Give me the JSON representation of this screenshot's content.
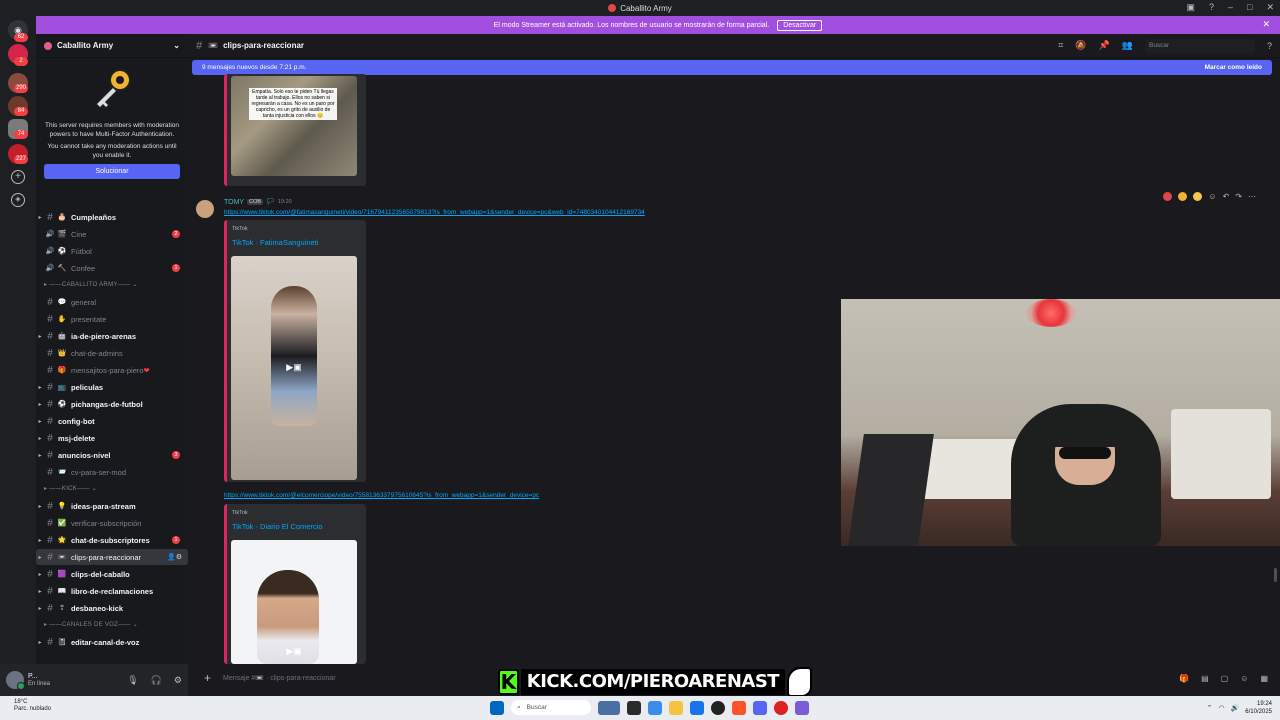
{
  "window": {
    "title": "Caballito Army"
  },
  "streamer_banner": {
    "text": "El modo Streamer está activado. Los nombres de usuario se mostrarán de forma parcial.",
    "button": "Desactivar"
  },
  "rail": {
    "badges": [
      "62",
      "2",
      "290",
      "84",
      "74",
      "227"
    ]
  },
  "server": {
    "name": "Caballito Army",
    "mfa_text_1": "This server requires members with moderation powers to have Multi-Factor Authentication.",
    "mfa_text_2": "You cannot take any moderation actions until you enable it.",
    "mfa_button": "Solucionar"
  },
  "channels": [
    {
      "label": "Cumpleaños",
      "emoji": "🎂",
      "bold": true,
      "arrow": true
    },
    {
      "label": "Cine",
      "emoji": "🎬",
      "voice": true,
      "badge": "2"
    },
    {
      "label": "Fútbol",
      "emoji": "⚽",
      "voice": true
    },
    {
      "label": "Confee",
      "emoji": "🔨",
      "voice": true,
      "badge": "1"
    },
    {
      "category": "CABALLITO ARMY"
    },
    {
      "label": "general",
      "emoji": "💬"
    },
    {
      "label": "presentate",
      "emoji": "✋"
    },
    {
      "label": "ia-de-piero-arenas",
      "emoji": "🤖",
      "bold": true,
      "arrow": true
    },
    {
      "label": "chat-de-admins",
      "emoji": "👑"
    },
    {
      "label": "mensajitos-para-piero",
      "emoji": "🎁",
      "heart": "❤"
    },
    {
      "label": "peliculas",
      "emoji": "📺",
      "bold": true,
      "arrow": true
    },
    {
      "label": "pichangas-de-futbol",
      "emoji": "⚽",
      "bold": true,
      "arrow": true
    },
    {
      "label": "config-bot",
      "bold": true,
      "arrow": true
    },
    {
      "label": "msj-delete",
      "bold": true,
      "arrow": true
    },
    {
      "label": "anuncios-nivel",
      "bold": true,
      "arrow": true,
      "badge": "3"
    },
    {
      "label": "cv-para-ser-mod",
      "emoji": "📨"
    },
    {
      "category": "KICK"
    },
    {
      "label": "ideas-para-stream",
      "emoji": "💡",
      "bold": true,
      "arrow": true
    },
    {
      "label": "verificar-subscripción",
      "emoji": "✅"
    },
    {
      "label": "chat-de-subscriptores",
      "emoji": "🌟",
      "bold": true,
      "arrow": true,
      "badge": "1"
    },
    {
      "label": "clips-para-reaccionar",
      "emoji": "📼",
      "active": true,
      "arrow": true
    },
    {
      "label": "clips-del-caballo",
      "emoji": "🟪",
      "bold": true,
      "arrow": true
    },
    {
      "label": "libro-de-reclamaciones",
      "emoji": "📖",
      "bold": true,
      "arrow": true
    },
    {
      "label": "desbaneo-kick",
      "emoji": "❣",
      "bold": true,
      "arrow": true
    },
    {
      "category": "CANALES DE VOZ"
    },
    {
      "label": "editar-canal-de-voz",
      "emoji": "📓",
      "bold": true,
      "arrow": true
    }
  ],
  "user_panel": {
    "name": "P...",
    "status": "En línea"
  },
  "channel_header": {
    "name": "clips-para-reaccionar",
    "search_placeholder": "Buscar"
  },
  "new_messages": {
    "text": "9 mensajes nuevos desde 7:21 p.m.",
    "mark_read": "Marcar como leído"
  },
  "first_embed": {
    "caption": "Empatía. Solo eso te piden Tú llegas tarde al trabajo. Ellos no saben si regresarán a casa. No es un paro por capricho, es un grito de auxilio de tanta injusticia con ellos 😔"
  },
  "message": {
    "author": "TOMY",
    "tag": "COB",
    "time": "19:20",
    "link1": "https://www.tiktok.com/@fatimasanguineti/video/7167941123565079813?is_from_webapp=1&sender_device=pc&web_id=7480340104412169734",
    "embed1_provider": "TikTok",
    "embed1_title": "TikTok · FatimaSanguineti",
    "link2": "https://www.tiktok.com/@elcomerciope/video/7558136337975610645?is_from_webapp=1&sender_device=pc",
    "embed2_provider": "TikTok",
    "embed2_title": "TikTok · Diario El Comercio"
  },
  "composer": {
    "placeholder": "Mensaje #📼 · clips-para-reaccionar"
  },
  "overlay": {
    "kick_url": "KICK.COM/PIEROARENAST",
    "kick_letter": "K"
  },
  "taskbar": {
    "weather_temp": "18°C",
    "weather_desc": "Parc. nublado",
    "search": "Buscar",
    "time": "19:24",
    "date": "6/10/2025"
  }
}
